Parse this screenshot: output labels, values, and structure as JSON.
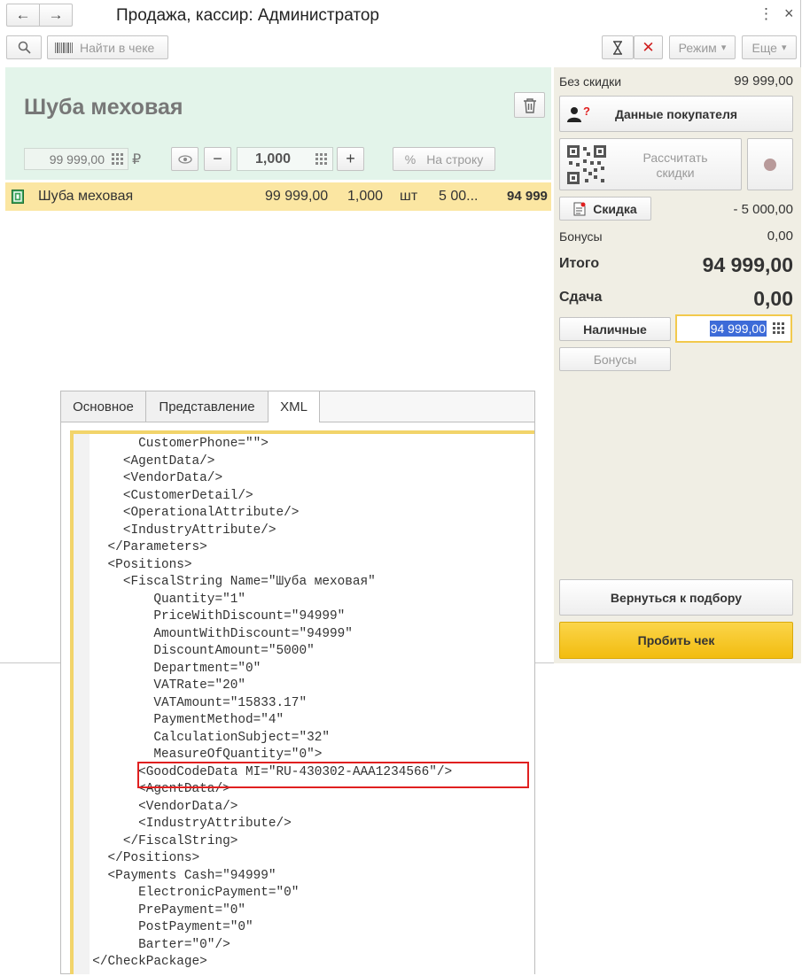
{
  "window": {
    "title": "Продажа, кассир: Администратор",
    "menu_glyph": "⋮",
    "close_glyph": "×",
    "back_glyph": "←",
    "forward_glyph": "→"
  },
  "toolbar": {
    "search_glyph": "⚲",
    "find_in_receipt": "Найти в чеке",
    "hourglass_glyph": "⌛",
    "cancel_glyph": "✕",
    "mode_label": "Режим",
    "more_label": "Еще",
    "dropdown_glyph": "▾"
  },
  "product": {
    "name": "Шуба меховая",
    "price": "99 999,00",
    "currency": "₽",
    "quantity": "1,000",
    "minus": "−",
    "plus": "+",
    "per_line_icon": "%",
    "per_line_label": "На строку"
  },
  "receipt": {
    "rows": [
      {
        "name": "Шуба меховая",
        "price": "99 999,00",
        "qty": "1,000",
        "unit": "шт",
        "discount": "5 00...",
        "sum": "94 999"
      }
    ]
  },
  "summary": {
    "no_discount_label": "Без скидки",
    "no_discount_value": "99 999,00",
    "customer_button": "Данные покупателя",
    "calc_discounts": "Рассчитать скидки",
    "discount_button": "Скидка",
    "discount_value": "- 5 000,00",
    "bonuses_label": "Бонусы",
    "bonuses_value": "0,00",
    "total_label": "Итого",
    "total_value": "94 999,00",
    "change_label": "Сдача",
    "change_value": "0,00",
    "cash_button": "Наличные",
    "cash_value": "94 999,00",
    "bonuses_button": "Бонусы",
    "back_to_selection": "Вернуться к подбору",
    "print_receipt": "Пробить чек"
  },
  "xml_panel": {
    "tabs": [
      "Основное",
      "Представление",
      "XML"
    ],
    "active_tab": 2,
    "lines": [
      "        CustomerPhone=\"\">",
      "      <AgentData/>",
      "      <VendorData/>",
      "      <CustomerDetail/>",
      "      <OperationalAttribute/>",
      "      <IndustryAttribute/>",
      "    </Parameters>",
      "    <Positions>",
      "      <FiscalString Name=\"Шуба меховая\"",
      "          Quantity=\"1\"",
      "          PriceWithDiscount=\"94999\"",
      "          AmountWithDiscount=\"94999\"",
      "          DiscountAmount=\"5000\"",
      "          Department=\"0\"",
      "          VATRate=\"20\"",
      "          VATAmount=\"15833.17\"",
      "          PaymentMethod=\"4\"",
      "          CalculationSubject=\"32\"",
      "          MeasureOfQuantity=\"0\">",
      "        <GoodCodeData MI=\"RU-430302-AAA1234566\"/>",
      "        <AgentData/>",
      "        <VendorData/>",
      "        <IndustryAttribute/>",
      "      </FiscalString>",
      "    </Positions>",
      "    <Payments Cash=\"94999\"",
      "        ElectronicPayment=\"0\"",
      "        PrePayment=\"0\"",
      "        PostPayment=\"0\"",
      "        Barter=\"0\"/>",
      "  </CheckPackage>"
    ],
    "highlight_line": 19
  },
  "colors": {
    "header_bg": "#e3f4ea",
    "row_highlight": "#fbe6a2",
    "right_panel_bg": "#f0eee4",
    "accent_yellow": "#f5c518",
    "highlight_frame": "#e02020"
  }
}
